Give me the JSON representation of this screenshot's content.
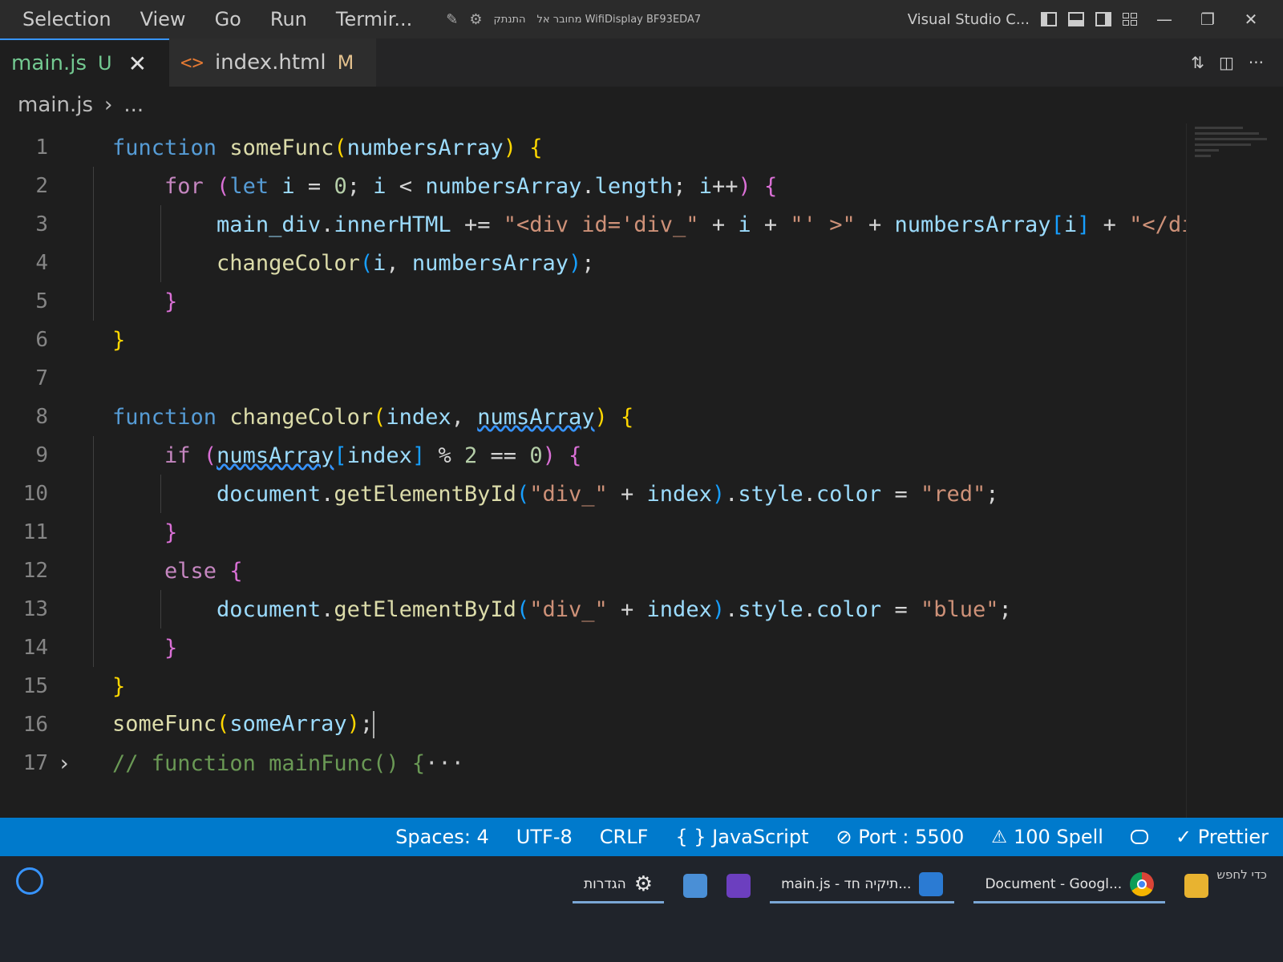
{
  "menu": {
    "items": [
      "Selection",
      "View",
      "Go",
      "Run",
      "Termir..."
    ]
  },
  "titlebar": {
    "hebrew_status": "התנתק",
    "wifi_display": "מחובר אל WifiDisplay BF93EDA7",
    "window_title": "Visual Studio C..."
  },
  "tabs": [
    {
      "label": "main.js",
      "badge": "U",
      "close": "✕"
    },
    {
      "label": "index.html",
      "badge": "M"
    }
  ],
  "breadcrumb": {
    "file": "main.js",
    "separator": "›",
    "rest": "..."
  },
  "editor": {
    "line_numbers": [
      "1",
      "2",
      "3",
      "4",
      "5",
      "6",
      "7",
      "8",
      "9",
      "10",
      "11",
      "12",
      "13",
      "14",
      "15",
      "16",
      "17"
    ],
    "fold_marker": "›",
    "folded_ellipsis": "···",
    "tokens": {
      "kw_function": "function",
      "kw_for": "for",
      "kw_let": "let",
      "kw_if": "if",
      "kw_else": "else",
      "fn_someFunc": "someFunc",
      "fn_changeColor": "changeColor",
      "fn_getById": "getElementById",
      "fn_mainFunc": "mainFunc",
      "var_numbersArray": "numbersArray",
      "var_i": "i",
      "var_length": "length",
      "var_main_div": "main_div",
      "var_innerHTML": "innerHTML",
      "var_index": "index",
      "var_numsArray": "numsArray",
      "var_document": "document",
      "var_style": "style",
      "var_color": "color",
      "var_someArray": "someArray",
      "str_div_open": "\"<div id='div_\"",
      "str_close_quote": "\"' >\"",
      "str_div_close": "\"</div>\"",
      "str_div_": "\"div_\"",
      "str_red": "\"red\"",
      "str_blue": "\"blue\"",
      "num_0": "0",
      "num_2": "2",
      "cmt_prefix": "//"
    }
  },
  "statusbar": {
    "spaces": "Spaces: 4",
    "encoding": "UTF-8",
    "eol": "CRLF",
    "language": "{ } JavaScript",
    "port": "⊘ Port : 5500",
    "spell": "100 Spell",
    "prettier": "✓ Prettier"
  },
  "taskbar": {
    "settings_label": "הגדרות",
    "vscode_label": "main.js - תיקיה חד...",
    "chrome_label": "Document - Googl...",
    "tray_text": "כדי לחפש"
  },
  "colors": {
    "status_bar": "#007acc",
    "keyword": "#569cd6",
    "control": "#c586c0",
    "function": "#dcdcaa",
    "variable": "#9cdcfe",
    "string": "#ce9178",
    "untracked": "#73c991",
    "modified": "#e2c08d"
  }
}
